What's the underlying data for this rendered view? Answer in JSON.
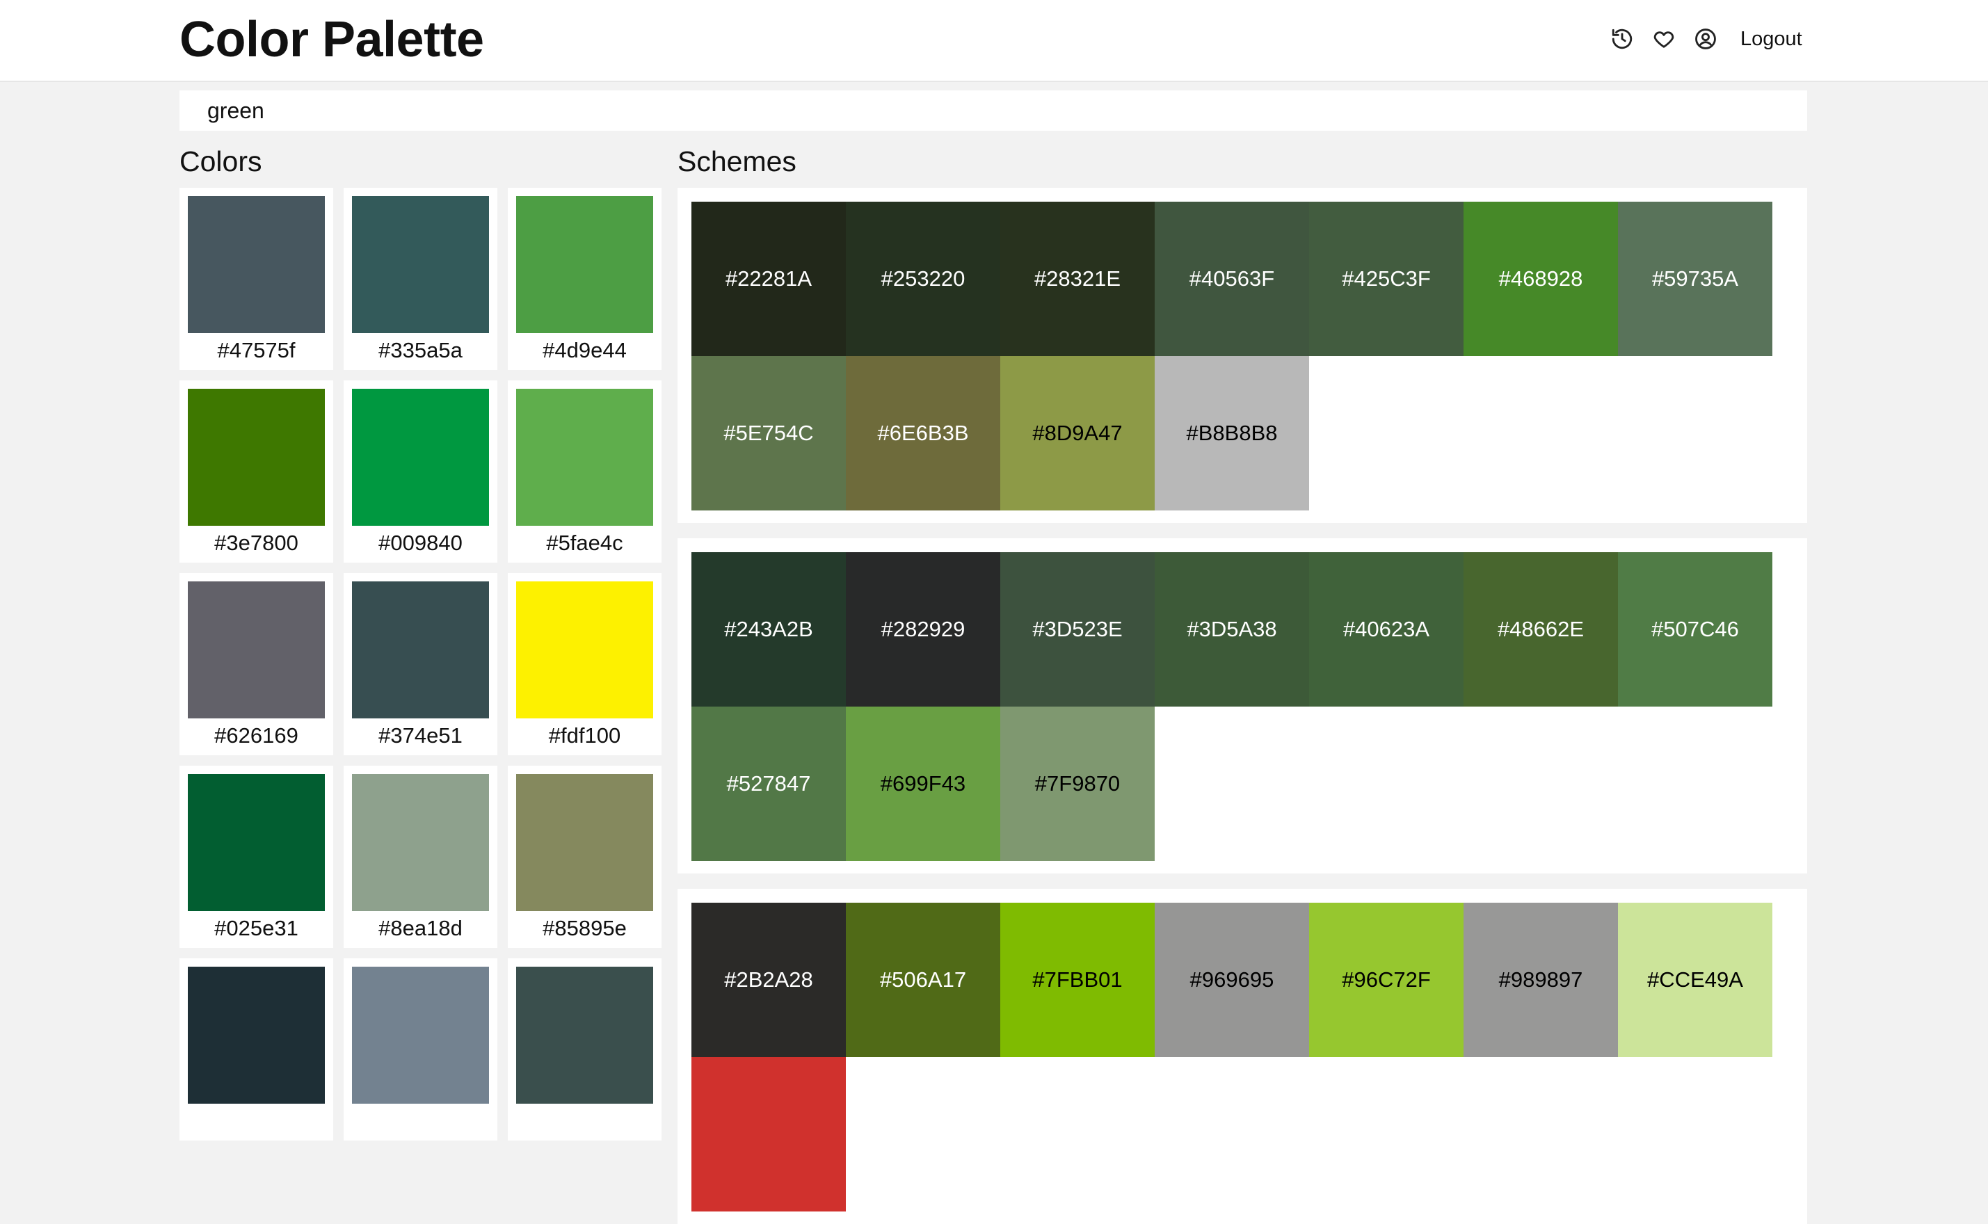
{
  "header": {
    "title": "Color Palette",
    "logout_label": "Logout",
    "icons": [
      "history-icon",
      "heart-icon",
      "user-circle-icon"
    ]
  },
  "search": {
    "value": "green",
    "placeholder": ""
  },
  "colors_section": {
    "heading": "Colors",
    "items": [
      {
        "hex": "#47575f",
        "color": "#47575f"
      },
      {
        "hex": "#335a5a",
        "color": "#335a5a"
      },
      {
        "hex": "#4d9e44",
        "color": "#4d9e44"
      },
      {
        "hex": "#3e7800",
        "color": "#3e7800"
      },
      {
        "hex": "#009840",
        "color": "#009840"
      },
      {
        "hex": "#5fae4c",
        "color": "#5fae4c"
      },
      {
        "hex": "#626169",
        "color": "#626169"
      },
      {
        "hex": "#374e51",
        "color": "#374e51"
      },
      {
        "hex": "#fdf100",
        "color": "#fdf100"
      },
      {
        "hex": "#025e31",
        "color": "#025e31"
      },
      {
        "hex": "#8ea18d",
        "color": "#8ea18d"
      },
      {
        "hex": "#85895e",
        "color": "#85895e"
      },
      {
        "hex": "",
        "color": "#1e2f36"
      },
      {
        "hex": "",
        "color": "#738290"
      },
      {
        "hex": "",
        "color": "#3a4f4d"
      }
    ]
  },
  "schemes_section": {
    "heading": "Schemes",
    "schemes": [
      {
        "colors": [
          {
            "hex": "#22281A",
            "text": "#ffffff"
          },
          {
            "hex": "#253220",
            "text": "#ffffff"
          },
          {
            "hex": "#28321E",
            "text": "#ffffff"
          },
          {
            "hex": "#40563F",
            "text": "#ffffff"
          },
          {
            "hex": "#425C3F",
            "text": "#ffffff"
          },
          {
            "hex": "#468928",
            "text": "#ffffff"
          },
          {
            "hex": "#59735A",
            "text": "#ffffff"
          },
          {
            "hex": "#5E754C",
            "text": "#ffffff"
          },
          {
            "hex": "#6E6B3B",
            "text": "#ffffff"
          },
          {
            "hex": "#8D9A47",
            "text": "#000000"
          },
          {
            "hex": "#B8B8B8",
            "text": "#000000"
          }
        ]
      },
      {
        "colors": [
          {
            "hex": "#243A2B",
            "text": "#ffffff"
          },
          {
            "hex": "#282929",
            "text": "#ffffff"
          },
          {
            "hex": "#3D523E",
            "text": "#ffffff"
          },
          {
            "hex": "#3D5A38",
            "text": "#ffffff"
          },
          {
            "hex": "#40623A",
            "text": "#ffffff"
          },
          {
            "hex": "#48662E",
            "text": "#ffffff"
          },
          {
            "hex": "#507C46",
            "text": "#ffffff"
          },
          {
            "hex": "#527847",
            "text": "#ffffff"
          },
          {
            "hex": "#699F43",
            "text": "#000000"
          },
          {
            "hex": "#7F9870",
            "text": "#000000"
          }
        ]
      },
      {
        "colors": [
          {
            "hex": "#2B2A28",
            "text": "#ffffff"
          },
          {
            "hex": "#506A17",
            "text": "#ffffff"
          },
          {
            "hex": "#7FBB01",
            "text": "#000000"
          },
          {
            "hex": "#969695",
            "text": "#000000"
          },
          {
            "hex": "#96C72F",
            "text": "#000000"
          },
          {
            "hex": "#989897",
            "text": "#000000"
          },
          {
            "hex": "#CCE49A",
            "text": "#000000"
          },
          {
            "hex": "",
            "color": "#D0312D",
            "text": "#ffffff"
          }
        ]
      }
    ]
  }
}
